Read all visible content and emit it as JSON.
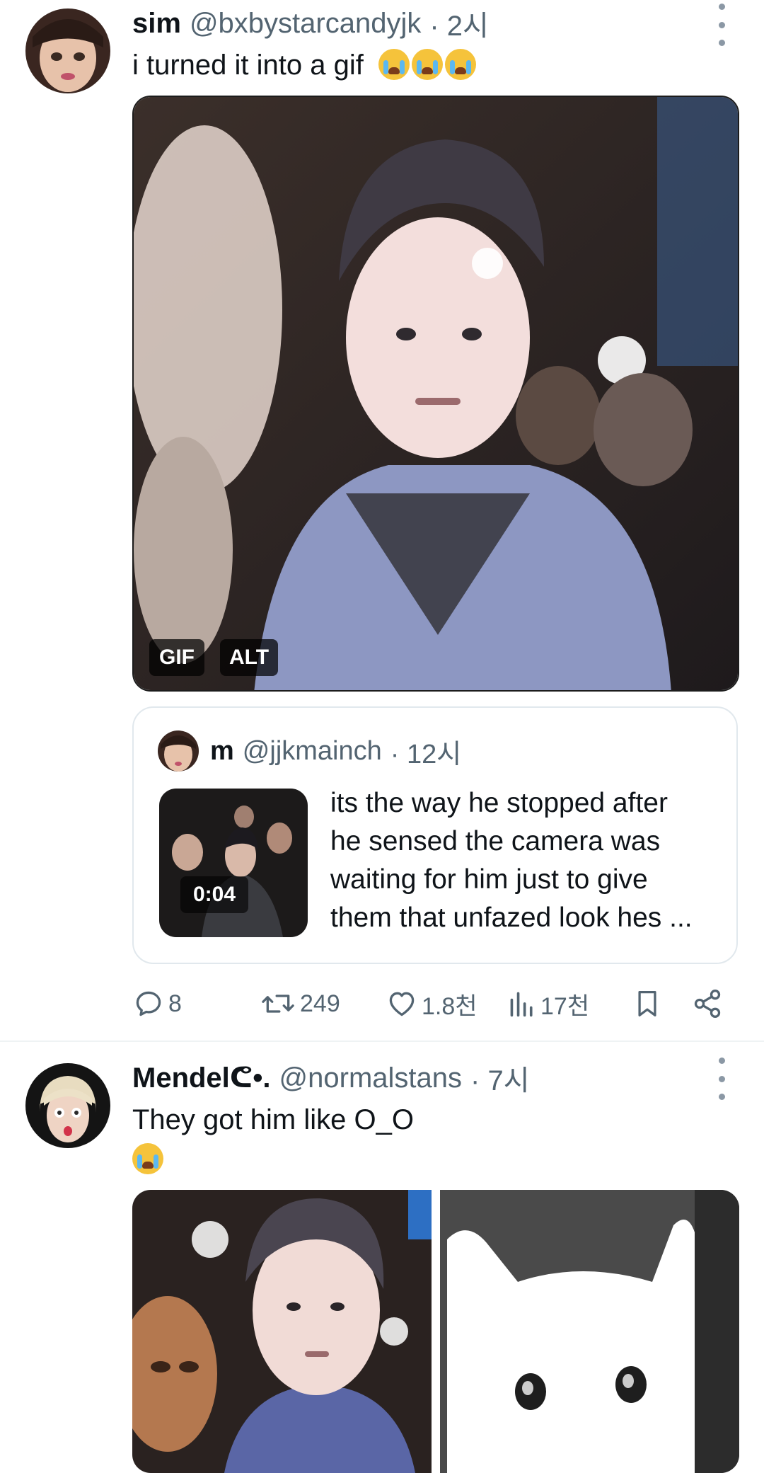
{
  "tweet1": {
    "name": "sim",
    "handle": "@bxbystarcandyjk",
    "time": "· 2시",
    "text": "i turned it into a gif",
    "emojis": [
      "loudly-crying-face",
      "loudly-crying-face",
      "loudly-crying-face"
    ],
    "media": {
      "badges": [
        "GIF",
        "ALT"
      ]
    },
    "quote": {
      "name": "m",
      "handle": "@jjkmainch",
      "time": "· 12시",
      "text_lines": [
        "its the way he stopped after",
        "he sensed the camera was",
        "waiting for him just to give",
        "them that unfazed look hes ..."
      ],
      "video_duration": "0:04"
    },
    "actions": {
      "replies": "8",
      "retweets": "249",
      "likes": "1.8천",
      "views": "17천"
    }
  },
  "tweet2": {
    "name": "Mendel",
    "name_suffix": "•.",
    "handle": "@normalstans",
    "time": "· 7시",
    "text": "They got him like O_O",
    "emojis": [
      "loudly-crying-face"
    ]
  },
  "colors": {
    "text_primary": "#0f1419",
    "text_secondary": "#536471",
    "border": "#e1e8ed",
    "divider": "#eff3f4",
    "background": "#ffffff"
  }
}
